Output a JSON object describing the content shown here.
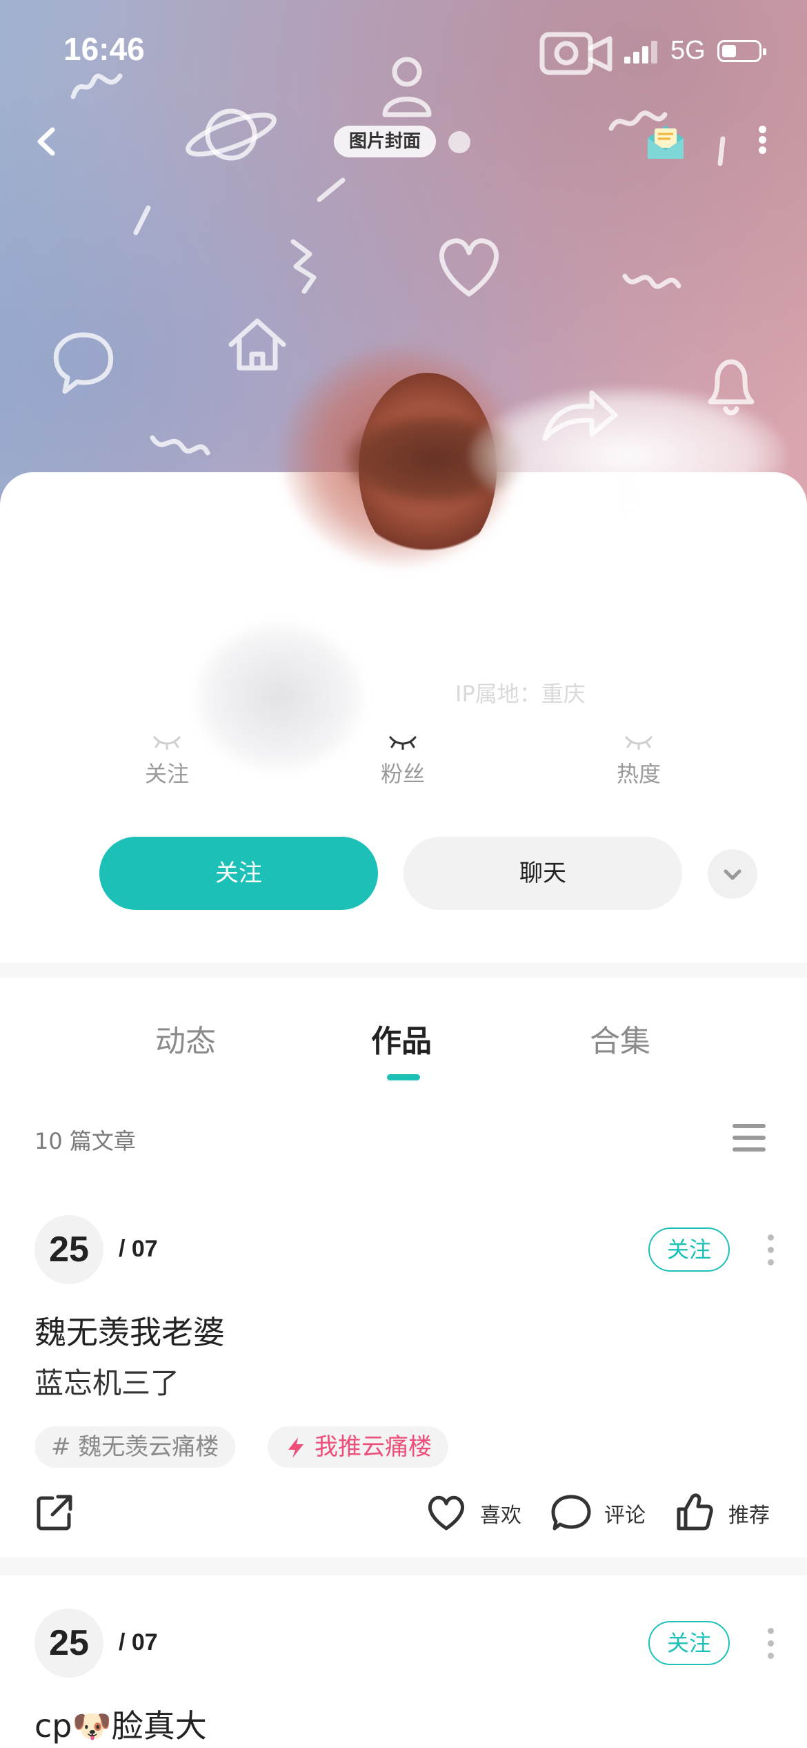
{
  "status": {
    "time": "16:46",
    "network": "5G"
  },
  "header": {
    "cover_chip": "图片封面",
    "back_icon": "chevron-left-icon",
    "mail_icon": "envelope-icon",
    "more_icon": "more-vertical-icon"
  },
  "profile": {
    "id_line": "IP属地：重庆",
    "stats": [
      {
        "label": "关注"
      },
      {
        "label": "粉丝"
      },
      {
        "label": "热度"
      }
    ],
    "follow_label": "关注",
    "chat_label": "聊天"
  },
  "tabs": [
    {
      "label": "动态"
    },
    {
      "label": "作品",
      "active": true
    },
    {
      "label": "合集"
    }
  ],
  "list": {
    "count_label": "10 篇文章"
  },
  "posts": [
    {
      "day": "25",
      "month": "/ 07",
      "follow_label": "关注",
      "title": "魏无羡我老婆",
      "body": "蓝忘机三了",
      "tags": [
        {
          "text": "# 魏无羡云痛楼",
          "style": "hash"
        },
        {
          "text": "我推云痛楼",
          "style": "hot"
        }
      ],
      "actions": {
        "like": "喜欢",
        "comment": "评论",
        "recommend": "推荐"
      }
    },
    {
      "day": "25",
      "month": "/ 07",
      "follow_label": "关注",
      "title": "cp🐶脸真大"
    }
  ],
  "colors": {
    "accent": "#1cc0b7",
    "hot_tag": "#ee4f7a"
  }
}
